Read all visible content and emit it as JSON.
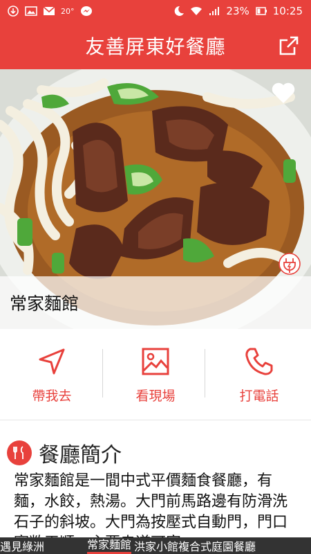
{
  "status_bar": {
    "temperature": "20°",
    "battery": "23%",
    "time": "10:25"
  },
  "app_bar": {
    "title": "友善屏東好餐廳"
  },
  "restaurant": {
    "name": "常家麵館"
  },
  "actions": [
    {
      "label": "帶我去"
    },
    {
      "label": "看現場"
    },
    {
      "label": "打電話"
    }
  ],
  "intro": {
    "title": "餐廳簡介",
    "text": "常家麵館是一間中式平價麵食餐廳，有麵，水餃，熱湯。大門前馬路邊有防滑洗石子的斜坡。大門為按壓式自動門，門口寬敞平順。主要走道可容"
  },
  "tabs": {
    "prev": "遇見綠洲",
    "current": "常家麵館",
    "next": "洪家小館複合式庭園餐廳"
  },
  "colors": {
    "accent": "#e8413c",
    "tab_bar": "#333333"
  }
}
